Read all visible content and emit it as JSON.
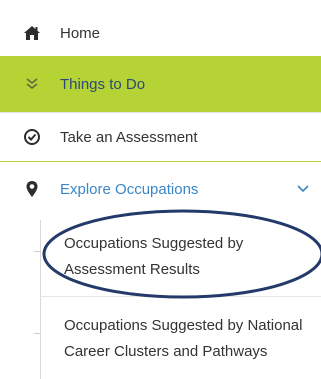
{
  "nav": {
    "items": [
      {
        "label": "Home",
        "icon": "home-icon"
      },
      {
        "label": "Things to Do",
        "icon": "double-chevron-down-icon"
      },
      {
        "label": "Take an Assessment",
        "icon": "check-circle-icon"
      },
      {
        "label": "Explore Occupations",
        "icon": "map-marker-icon",
        "expanded": true
      }
    ],
    "submenu": [
      {
        "label": "Occupations Suggested by Assessment Results",
        "highlighted": true
      },
      {
        "label": "Occupations Suggested by National Career Clusters and Pathways"
      }
    ]
  },
  "colors": {
    "active_bg": "#b5d334",
    "link_blue": "#3a86c6",
    "annotation_ellipse": "#233a6b"
  }
}
